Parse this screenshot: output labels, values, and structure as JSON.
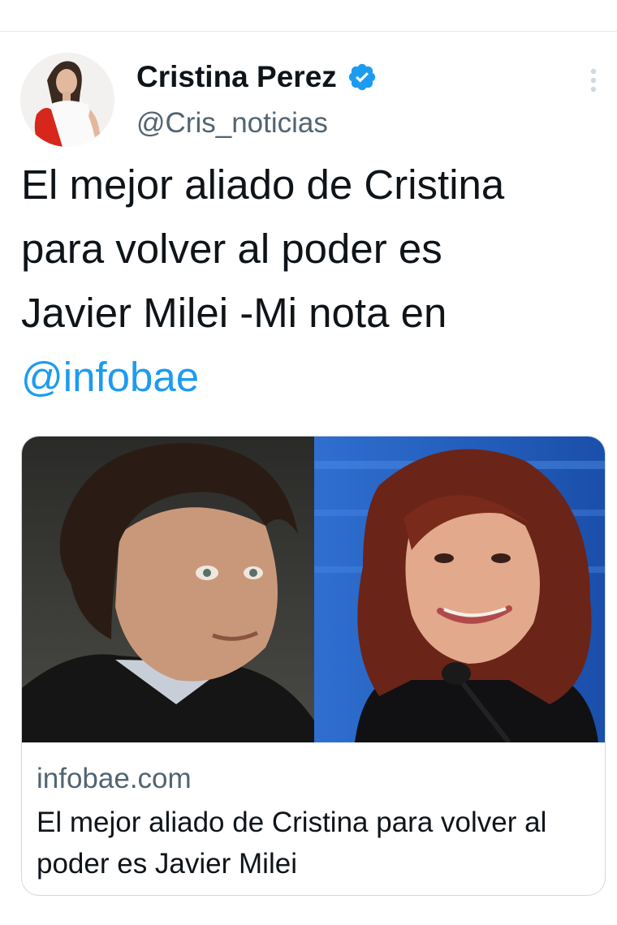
{
  "tweet": {
    "author": {
      "display_name": "Cristina Perez",
      "handle": "@Cris_noticias",
      "verified": true
    },
    "text_lines": [
      "El mejor aliado de Cristina",
      "para volver al poder es",
      "Javier Milei -Mi nota en"
    ],
    "mention": "@infobae",
    "link_card": {
      "domain": "infobae.com",
      "title": "El mejor aliado de Cristina para volver al poder es Javier Milei"
    }
  },
  "colors": {
    "link": "#1d9bf0",
    "verified_badge": "#1d9bf0",
    "secondary_text": "#536471",
    "border": "#cfd9de"
  },
  "icons": {
    "verified": "verified-badge-icon",
    "more": "more-options-icon"
  }
}
